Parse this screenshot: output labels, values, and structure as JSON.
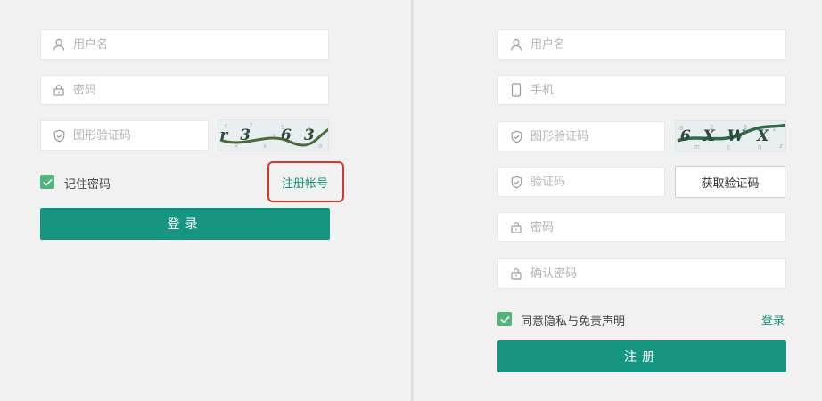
{
  "login": {
    "username_placeholder": "用户名",
    "password_placeholder": "密码",
    "captcha_placeholder": "图形验证码",
    "captcha_text": "r3 63",
    "remember_label": "记住密码",
    "register_link": "注册帐号",
    "submit_label": "登录"
  },
  "register": {
    "username_placeholder": "用户名",
    "phone_placeholder": "手机",
    "captcha_placeholder": "图形验证码",
    "captcha_text": "6XWX",
    "code_placeholder": "验证码",
    "get_code_label": "获取验证码",
    "password_placeholder": "密码",
    "confirm_password_placeholder": "确认密码",
    "agree_label": "同意隐私与免责声明",
    "login_link": "登录",
    "submit_label": "注册"
  },
  "colors": {
    "primary": "#169581",
    "link": "#15907d",
    "checkbox": "#4fb57a",
    "highlight": "#d6372b",
    "background": "#f1f1f1"
  },
  "icons": {
    "user": "user-icon",
    "lock": "lock-icon",
    "shield": "shield-icon",
    "phone": "phone-icon",
    "check": "check-icon"
  }
}
